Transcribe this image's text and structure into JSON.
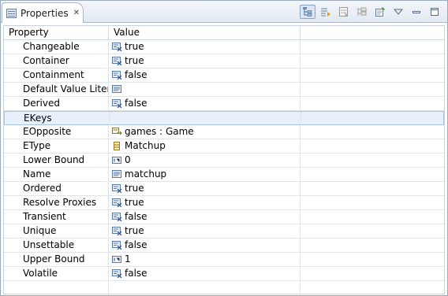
{
  "view": {
    "tab_title": "Properties",
    "tab_icon": "properties-view-icon",
    "toolbar": [
      {
        "name": "show-categories-icon",
        "active": true
      },
      {
        "name": "show-advanced-properties-icon",
        "active": false
      },
      {
        "name": "restore-default-value-icon",
        "active": false
      },
      {
        "name": "filter-properties-icon",
        "active": false
      },
      {
        "name": "pin-to-selection-icon",
        "active": false
      },
      {
        "name": "view-menu-icon",
        "active": false
      },
      {
        "name": "minimize-icon",
        "active": false
      },
      {
        "name": "maximize-icon",
        "active": false
      }
    ]
  },
  "table": {
    "columns": {
      "property": "Property",
      "value": "Value"
    },
    "rows": [
      {
        "property": "Changeable",
        "icon": "boolean-value-icon",
        "value": "true"
      },
      {
        "property": "Container",
        "icon": "boolean-value-icon",
        "value": "true"
      },
      {
        "property": "Containment",
        "icon": "boolean-value-icon",
        "value": "false"
      },
      {
        "property": "Default Value Literal",
        "icon": "text-value-icon",
        "value": ""
      },
      {
        "property": "Derived",
        "icon": "boolean-value-icon",
        "value": "false"
      },
      {
        "property": "EKeys",
        "icon": "",
        "value": "",
        "selected": true
      },
      {
        "property": "EOpposite",
        "icon": "reference-value-icon",
        "value": "games : Game"
      },
      {
        "property": "EType",
        "icon": "class-value-icon",
        "value": "Matchup"
      },
      {
        "property": "Lower Bound",
        "icon": "integer-value-icon",
        "value": "0"
      },
      {
        "property": "Name",
        "icon": "text-value-icon",
        "value": "matchup"
      },
      {
        "property": "Ordered",
        "icon": "boolean-value-icon",
        "value": "true"
      },
      {
        "property": "Resolve Proxies",
        "icon": "boolean-value-icon",
        "value": "true"
      },
      {
        "property": "Transient",
        "icon": "boolean-value-icon",
        "value": "false"
      },
      {
        "property": "Unique",
        "icon": "boolean-value-icon",
        "value": "true"
      },
      {
        "property": "Unsettable",
        "icon": "boolean-value-icon",
        "value": "false"
      },
      {
        "property": "Upper Bound",
        "icon": "integer-value-icon",
        "value": "1"
      },
      {
        "property": "Volatile",
        "icon": "boolean-value-icon",
        "value": "false"
      }
    ]
  },
  "colors": {
    "selection_bg": "#e8f0fb",
    "selection_border": "#a8c1e6",
    "header_border": "#9aa9bc",
    "grid_line": "#e1e5ea"
  }
}
